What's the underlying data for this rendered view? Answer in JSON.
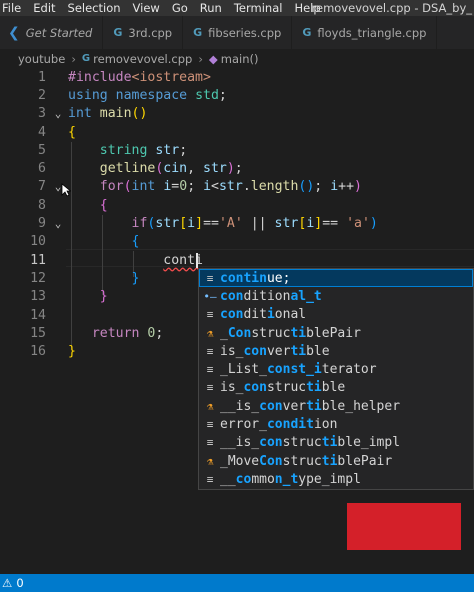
{
  "menubar": {
    "items": [
      "File",
      "Edit",
      "Selection",
      "View",
      "Go",
      "Run",
      "Terminal",
      "Help"
    ],
    "window_title": "removevovel.cpp - DSA_by_"
  },
  "tabs": [
    {
      "label": "Get Started",
      "icon": "vscode-icon"
    },
    {
      "label": "3rd.cpp",
      "icon": "cpp-file-icon"
    },
    {
      "label": "fibseries.cpp",
      "icon": "cpp-file-icon"
    },
    {
      "label": "floyds_triangle.cpp",
      "icon": "cpp-file-icon"
    }
  ],
  "breadcrumb": {
    "folder": "youtube",
    "file": "removevovel.cpp",
    "symbol": "main()"
  },
  "editor": {
    "line_numbers": [
      "1",
      "2",
      "3",
      "4",
      "5",
      "6",
      "7",
      "8",
      "9",
      "10",
      "11",
      "12",
      "13",
      "14",
      "15",
      "16"
    ],
    "active_line": "11",
    "typed_text": "conti"
  },
  "suggestions": [
    {
      "icon": "keyword-icon",
      "pre": "",
      "hl": "contin",
      "post": "ue;",
      "hl2": "",
      "post2": ""
    },
    {
      "icon": "type-icon",
      "pre": "",
      "hl": "con",
      "post": "dition",
      "hl2": "al_t",
      "post2": ""
    },
    {
      "icon": "text-icon",
      "pre": "",
      "hl": "con",
      "post": "dit",
      "hl2": "i",
      "post2": "onal"
    },
    {
      "icon": "class-icon",
      "pre": "_",
      "hl": "Con",
      "post": "struc",
      "hl2": "ti",
      "post2": "blePair"
    },
    {
      "icon": "text-icon",
      "pre": "is_",
      "hl": "con",
      "post": "ver",
      "hl2": "ti",
      "post2": "ble"
    },
    {
      "icon": "text-icon",
      "pre": "_List_",
      "hl": "const_i",
      "post": "terator",
      "hl2": "",
      "post2": ""
    },
    {
      "icon": "text-icon",
      "pre": "is_",
      "hl": "con",
      "post": "struc",
      "hl2": "ti",
      "post2": "ble"
    },
    {
      "icon": "class-icon",
      "pre": "__is_",
      "hl": "con",
      "post": "ver",
      "hl2": "ti",
      "post2": "ble_helper"
    },
    {
      "icon": "text-icon",
      "pre": "error_",
      "hl": "cond",
      "post": "",
      "hl2": "it",
      "post2": "ion"
    },
    {
      "icon": "text-icon",
      "pre": "__is_",
      "hl": "con",
      "post": "struc",
      "hl2": "ti",
      "post2": "ble_impl"
    },
    {
      "icon": "class-icon",
      "pre": "_Move",
      "hl": "Con",
      "post": "struc",
      "hl2": "ti",
      "post2": "blePair"
    },
    {
      "icon": "text-icon",
      "pre": "__",
      "hl": "co",
      "post": "mmo",
      "hl2": "n_t",
      "post2": "ype_impl"
    }
  ],
  "statusbar": {
    "warnings": "0"
  },
  "colors": {
    "accent": "#007acc",
    "selected_suggestion": "#04395e",
    "red_box": "#d42029"
  }
}
